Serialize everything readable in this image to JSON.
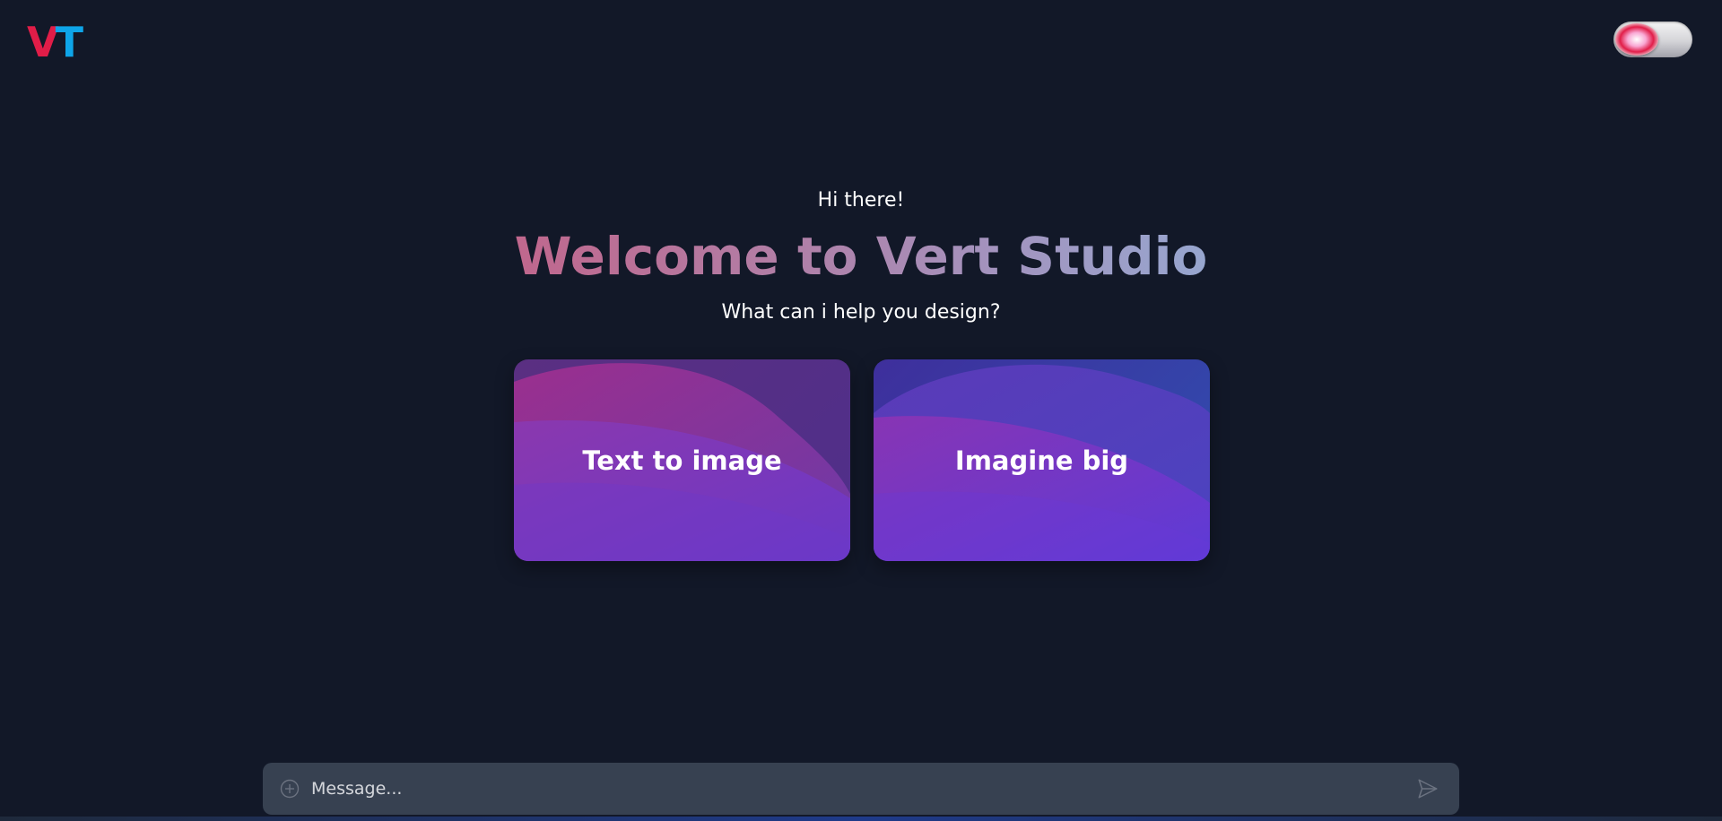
{
  "header": {
    "logo_left": "V",
    "logo_right": "T",
    "theme_toggle_icon": "theme-toggle-icon"
  },
  "hero": {
    "greeting": "Hi there!",
    "title": "Welcome to Vert Studio",
    "subtitle": "What can i help you design?"
  },
  "cards": [
    {
      "label": "Text to image"
    },
    {
      "label": "Imagine big"
    }
  ],
  "composer": {
    "placeholder": "Message...",
    "attach_icon": "plus-circle-icon",
    "send_icon": "send-icon"
  },
  "colors": {
    "background": "#121828",
    "logo_v": "#e11d48",
    "logo_t": "#0ea5e9",
    "composer_bg": "#374151"
  }
}
